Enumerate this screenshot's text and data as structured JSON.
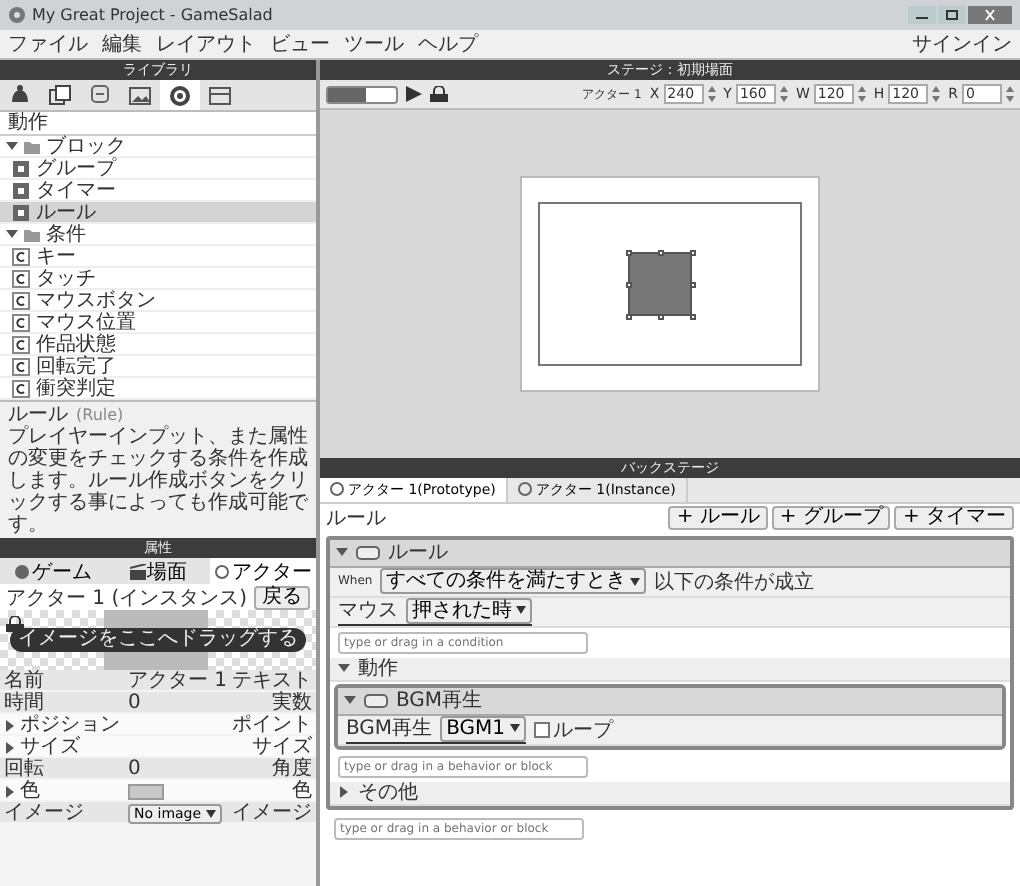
{
  "window": {
    "title": "My Great Project - GameSalad"
  },
  "menu": [
    "ファイル",
    "編集",
    "レイアウト",
    "ビュー",
    "ツール",
    "ヘルプ"
  ],
  "signin": "サインイン",
  "library": {
    "title": "ライブラリ",
    "tabs": [
      {
        "selected": false
      },
      {
        "selected": false
      },
      {
        "selected": false
      },
      {
        "selected": false
      },
      {
        "selected": true
      },
      {
        "selected": false
      }
    ],
    "section": "動作",
    "tree": [
      {
        "label": "ブロック",
        "expanded": true,
        "children": [
          {
            "label": "グループ",
            "kind": "block",
            "selected": false
          },
          {
            "label": "タイマー",
            "kind": "block",
            "selected": false
          },
          {
            "label": "ルール",
            "kind": "block",
            "selected": true
          }
        ]
      },
      {
        "label": "条件",
        "expanded": true,
        "children": [
          {
            "label": "キー",
            "kind": "condition",
            "selected": false
          },
          {
            "label": "タッチ",
            "kind": "condition",
            "selected": false
          },
          {
            "label": "マウスボタン",
            "kind": "condition",
            "selected": false
          },
          {
            "label": "マウス位置",
            "kind": "condition",
            "selected": false
          },
          {
            "label": "作品状態",
            "kind": "condition",
            "selected": false
          },
          {
            "label": "回転完了",
            "kind": "condition",
            "selected": false
          },
          {
            "label": "衝突判定",
            "kind": "condition",
            "selected": false
          }
        ]
      }
    ],
    "description": {
      "title": "ルール",
      "subtitle": "(Rule)",
      "text": "プレイヤーインプット、また属性の変更をチェックする条件を作成します。ルール作成ボタンをクリックする事によっても作成可能です。"
    }
  },
  "attributes": {
    "title": "属性",
    "tabs": [
      {
        "label": "ゲーム",
        "selected": false
      },
      {
        "label": "場面",
        "selected": false
      },
      {
        "label": "アクター",
        "selected": true
      }
    ],
    "actor": "アクター 1 (インスタンス)",
    "back": "戻る",
    "drop_hint": "イメージをここへドラッグする",
    "rows": [
      {
        "kind": "text",
        "name": "名前",
        "value": "アクター 1",
        "type": "テキスト"
      },
      {
        "kind": "text",
        "name": "時間",
        "value": "0",
        "type": "実数"
      },
      {
        "kind": "group",
        "name": "ポジション",
        "type": "ポイント",
        "expanded": false
      },
      {
        "kind": "group",
        "name": "サイズ",
        "type": "サイズ",
        "expanded": false
      },
      {
        "kind": "text",
        "name": "回転",
        "value": "0",
        "type": "角度"
      },
      {
        "kind": "swatch",
        "name": "色",
        "type": "色",
        "expanded": false
      },
      {
        "kind": "dropdown",
        "name": "イメージ",
        "value": "No image",
        "type": "イメージ"
      }
    ]
  },
  "stage": {
    "title": "ステージ：初期場面",
    "actor": "アクター 1",
    "zoom": {
      "level": 0.55
    },
    "fields": [
      {
        "label": "X",
        "value": "240"
      },
      {
        "label": "Y",
        "value": "160"
      },
      {
        "label": "W",
        "value": "120"
      },
      {
        "label": "H",
        "value": "120"
      },
      {
        "label": "R",
        "value": "0"
      }
    ]
  },
  "backstage": {
    "title": "バックステージ",
    "tabs": [
      {
        "label": "アクター 1(Prototype)",
        "selected": true
      },
      {
        "label": "アクター 1(Instance)",
        "selected": false
      }
    ],
    "heading": "ルール",
    "buttons": [
      "+ ルール",
      "+ グループ",
      "+ タイマー"
    ],
    "rule": {
      "title": "ルール",
      "expanded": true,
      "when_label": "When",
      "when_value": "すべての条件を満たすとき",
      "when_suffix": "以下の条件が成立",
      "condition": {
        "label": "マウス",
        "value": "押された時"
      },
      "condition_placeholder": "type or drag in a condition",
      "actions_label": "動作",
      "actions_expanded": true,
      "behavior": {
        "title": "BGM再生",
        "expanded": true,
        "label": "BGM再生",
        "value": "BGM1",
        "loop_label": "ループ",
        "loop": false
      },
      "behavior_placeholder": "type or drag in a behavior or block",
      "other_label": "その他",
      "other_expanded": false
    },
    "placeholder": "type or drag in a behavior or block"
  }
}
